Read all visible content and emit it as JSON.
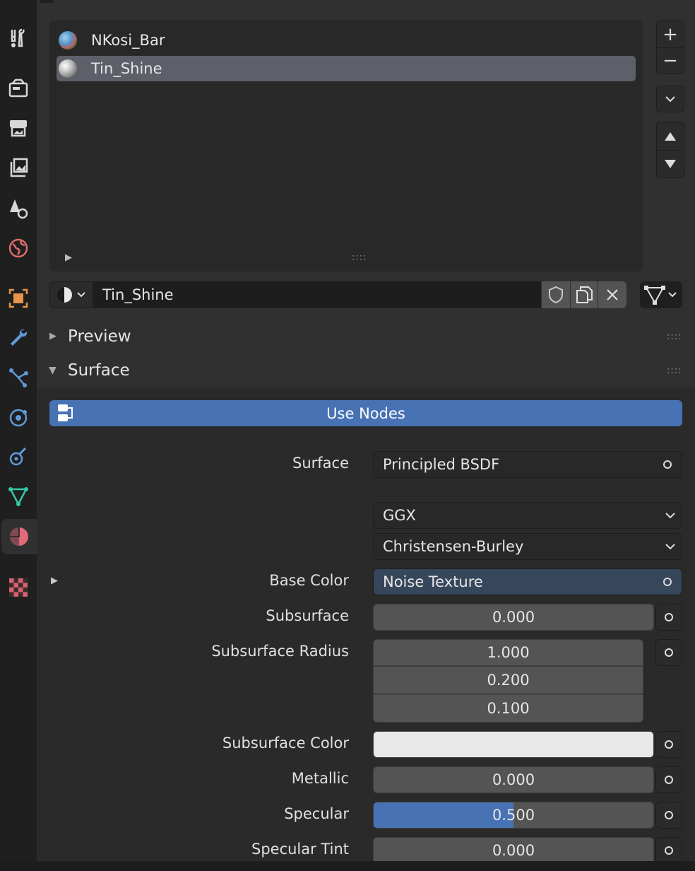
{
  "tabs": [
    {
      "name": "tool-tab",
      "icon": "wrench-screwdriver-icon"
    },
    {
      "name": "render-tab",
      "icon": "camera-back-icon"
    },
    {
      "name": "output-tab",
      "icon": "printer-icon"
    },
    {
      "name": "view-layer-tab",
      "icon": "image-stack-icon"
    },
    {
      "name": "scene-tab",
      "icon": "scene-cone-sphere-icon"
    },
    {
      "name": "world-tab",
      "icon": "world-globe-icon"
    },
    {
      "name": "object-tab",
      "icon": "object-square-icon"
    },
    {
      "name": "modifier-tab",
      "icon": "wrench-icon"
    },
    {
      "name": "particles-tab",
      "icon": "particles-icon"
    },
    {
      "name": "physics-tab",
      "icon": "physics-orbit-icon"
    },
    {
      "name": "constraints-tab",
      "icon": "constraint-icon"
    },
    {
      "name": "data-tab",
      "icon": "mesh-triangle-icon"
    },
    {
      "name": "material-tab",
      "icon": "material-sphere-icon"
    },
    {
      "name": "texture-tab",
      "icon": "checker-texture-icon"
    }
  ],
  "material_slots": [
    {
      "label": "NKosi_Bar",
      "icon": "globe-material-icon"
    },
    {
      "label": "Tin_Shine",
      "icon": "grey-sphere-material-icon"
    }
  ],
  "list_buttons": {
    "add": "+",
    "remove": "−"
  },
  "material_name": "Tin_Shine",
  "panels": {
    "preview": "Preview",
    "surface": "Surface"
  },
  "use_nodes_label": "Use Nodes",
  "props": {
    "surface_label": "Surface",
    "surface_value": "Principled BSDF",
    "distribution": "GGX",
    "subsurface_method": "Christensen-Burley",
    "base_color_label": "Base Color",
    "base_color_value": "Noise Texture",
    "subsurface_label": "Subsurface",
    "subsurface_value": "0.000",
    "subsurface_radius_label": "Subsurface Radius",
    "subsurface_radius": [
      "1.000",
      "0.200",
      "0.100"
    ],
    "subsurface_color_label": "Subsurface Color",
    "subsurface_color": "#e8e8e8",
    "metallic_label": "Metallic",
    "metallic_value": "0.000",
    "specular_label": "Specular",
    "specular_value": "0.500",
    "specular_fraction": 0.5,
    "specular_tint_label": "Specular Tint",
    "specular_tint_value": "0.000"
  },
  "colors": {
    "accent": "#4772b3",
    "bg": "#303030",
    "field": "#545454"
  }
}
